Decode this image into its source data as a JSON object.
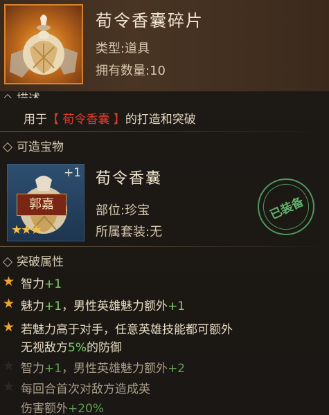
{
  "item": {
    "title": "荀令香囊碎片",
    "type_label": "类型:道具",
    "owned_label": "拥有数量:10"
  },
  "description": {
    "section_label": "描述",
    "text_before": "用于",
    "highlight": "【 荀令香囊 】",
    "text_after": "的打造和突破"
  },
  "craftable": {
    "section_label": "可造宝物",
    "plus_level": "+1",
    "hero_name": "郭嘉",
    "stars": "★★★",
    "name": "荀令香囊",
    "part_label": "部位:珍宝",
    "set_label": "所属套装:无",
    "stamp_text": "已装备"
  },
  "breakthrough": {
    "section_label": "突破属性",
    "rows": [
      {
        "active": true,
        "parts": [
          {
            "t": "智力"
          },
          {
            "t": "+1",
            "g": true
          }
        ]
      },
      {
        "active": true,
        "parts": [
          {
            "t": "魅力"
          },
          {
            "t": "+1",
            "g": true
          },
          {
            "t": "，男性英雄魅力额外"
          },
          {
            "t": "+1",
            "g": true
          }
        ]
      },
      {
        "active": true,
        "parts": [
          {
            "t": "若魅力高于对手，任意英雄技能都可额外"
          }
        ]
      },
      {
        "active": true,
        "cont": true,
        "parts": [
          {
            "t": "无视敌方"
          },
          {
            "t": "5%",
            "g": true
          },
          {
            "t": "的防御"
          }
        ]
      },
      {
        "active": false,
        "parts": [
          {
            "t": "智力"
          },
          {
            "t": "+1",
            "g": true
          },
          {
            "t": "，男性英雄魅力额外"
          },
          {
            "t": "+2",
            "g": true
          }
        ]
      },
      {
        "active": false,
        "parts": [
          {
            "t": "每回合首次对敌方造成英"
          }
        ]
      },
      {
        "active": false,
        "cont": true,
        "parts": [
          {
            "t": "伤害额外"
          },
          {
            "t": "+20%",
            "g": true
          }
        ]
      }
    ]
  },
  "colors": {
    "accent_green": "#7ed56a",
    "highlight_red": "#e23a2c",
    "star_gold": "#f0a52c"
  }
}
